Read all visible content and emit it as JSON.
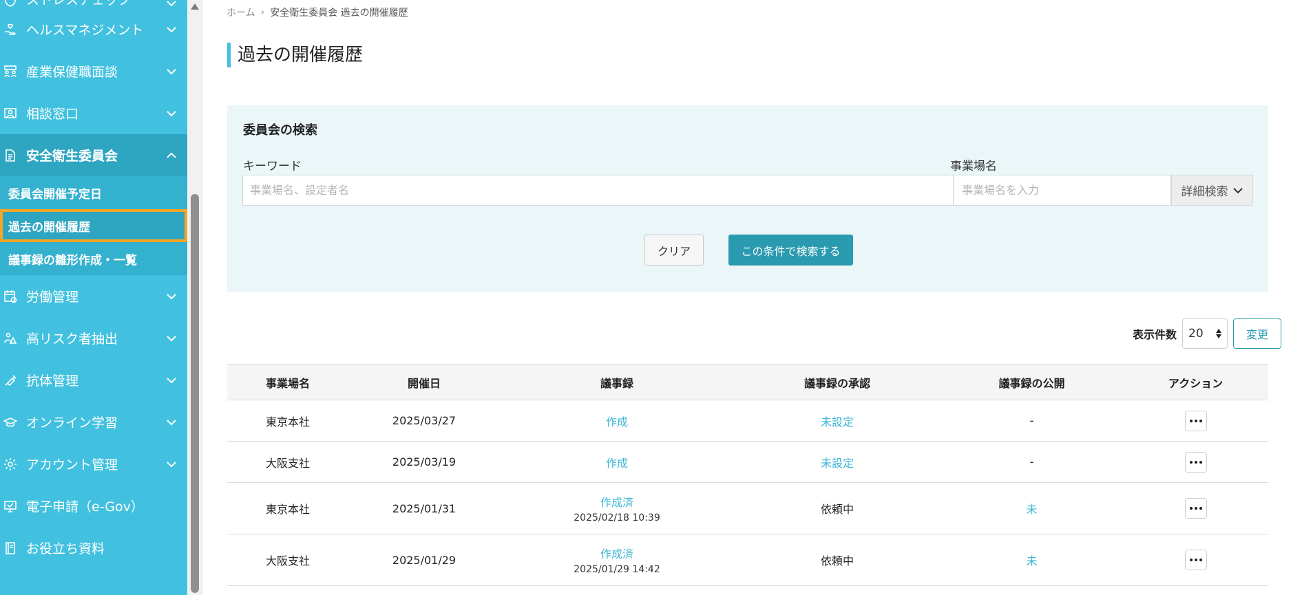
{
  "sidebar": {
    "items": [
      {
        "label": "ストレスチェック",
        "icon": "heart-shield-icon"
      },
      {
        "label": "ヘルスマネジメント",
        "icon": "hand-heart-icon"
      },
      {
        "label": "産業保健職面談",
        "icon": "people-meeting-icon"
      },
      {
        "label": "相談窓口",
        "icon": "person-card-icon"
      },
      {
        "label": "安全衛生委員会",
        "icon": "document-icon"
      },
      {
        "label": "労働管理",
        "icon": "calendar-clock-icon"
      },
      {
        "label": "高リスク者抽出",
        "icon": "person-warning-icon"
      },
      {
        "label": "抗体管理",
        "icon": "syringe-icon"
      },
      {
        "label": "オンライン学習",
        "icon": "graduation-cap-icon"
      },
      {
        "label": "アカウント管理",
        "icon": "gear-icon"
      },
      {
        "label": "電子申請（e-Gov）",
        "icon": "monitor-check-icon"
      },
      {
        "label": "お役立ち資料",
        "icon": "book-icon"
      }
    ],
    "sub_items": [
      {
        "label": "委員会開催予定日"
      },
      {
        "label": "過去の開催履歴"
      },
      {
        "label": "議事録の雛形作成・一覧"
      }
    ]
  },
  "breadcrumb": {
    "home": "ホーム",
    "separator": "›",
    "current": "安全衛生委員会 過去の開催履歴"
  },
  "page_title": "過去の開催履歴",
  "search": {
    "title": "委員会の検索",
    "keyword_label": "キーワード",
    "keyword_placeholder": "事業場名、設定者名",
    "site_label": "事業場名",
    "site_placeholder": "事業場名を入力",
    "detail_label": "詳細検索",
    "clear_label": "クリア",
    "submit_label": "この条件で検索する"
  },
  "pagination": {
    "count_label": "表示件数",
    "count_value": "20",
    "change_label": "変更"
  },
  "table": {
    "headers": [
      "事業場名",
      "開催日",
      "議事録",
      "議事録の承認",
      "議事録の公開",
      "アクション"
    ],
    "rows": [
      {
        "site": "東京本社",
        "date": "2025/03/27",
        "minutes": "作成",
        "minutes_ts": "",
        "approval": "未設定",
        "publish": "-"
      },
      {
        "site": "大阪支社",
        "date": "2025/03/19",
        "minutes": "作成",
        "minutes_ts": "",
        "approval": "未設定",
        "publish": "-"
      },
      {
        "site": "東京本社",
        "date": "2025/01/31",
        "minutes": "作成済",
        "minutes_ts": "2025/02/18 10:39",
        "approval": "依頼中",
        "publish": "未"
      },
      {
        "site": "大阪支社",
        "date": "2025/01/29",
        "minutes": "作成済",
        "minutes_ts": "2025/01/29 14:42",
        "approval": "依頼中",
        "publish": "未"
      }
    ]
  },
  "colors": {
    "sidebar_bg": "#41c1df",
    "sidebar_active": "#2ea5c1",
    "highlight_border": "#f5a623",
    "primary_button": "#2a9ab0",
    "link": "#3cb5d4",
    "search_panel_bg": "#ebf6f8"
  }
}
